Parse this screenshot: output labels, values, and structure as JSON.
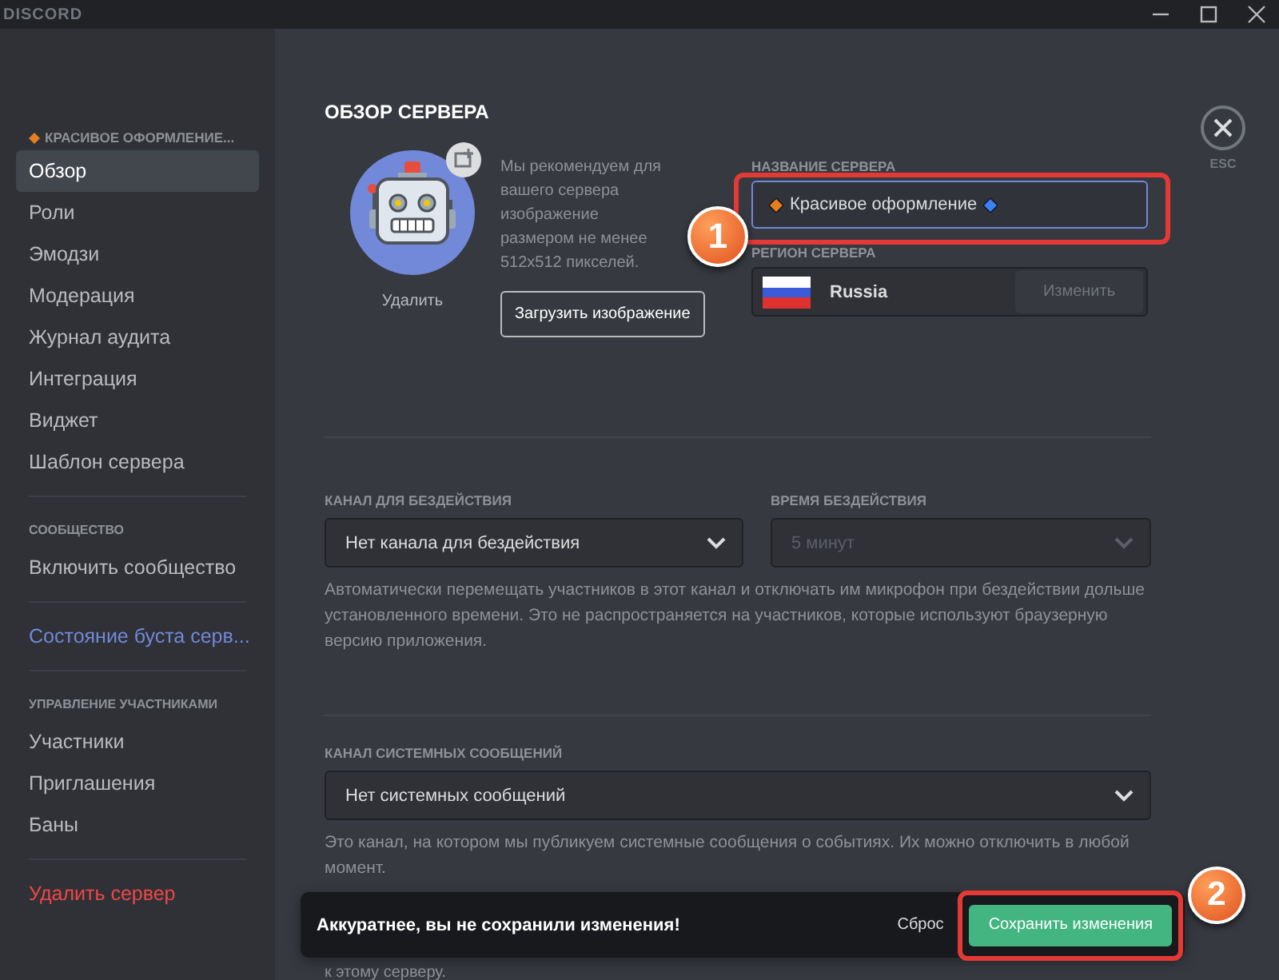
{
  "titlebar": {
    "app_name": "DISCORD"
  },
  "sidebar": {
    "server_name": "КРАСИВОЕ ОФОРМЛЕНИЕ...",
    "sections": [
      {
        "items": [
          {
            "label": "Обзор",
            "selected": true,
            "kind": "normal"
          },
          {
            "label": "Роли",
            "selected": false,
            "kind": "normal"
          },
          {
            "label": "Эмодзи",
            "selected": false,
            "kind": "normal"
          },
          {
            "label": "Модерация",
            "selected": false,
            "kind": "normal"
          },
          {
            "label": "Журнал аудита",
            "selected": false,
            "kind": "normal"
          },
          {
            "label": "Интеграция",
            "selected": false,
            "kind": "normal"
          },
          {
            "label": "Виджет",
            "selected": false,
            "kind": "normal"
          },
          {
            "label": "Шаблон сервера",
            "selected": false,
            "kind": "normal"
          }
        ]
      },
      {
        "heading": "СООБЩЕСТВО",
        "items": [
          {
            "label": "Включить сообщество",
            "selected": false,
            "kind": "normal"
          }
        ]
      },
      {
        "items": [
          {
            "label": "Состояние буста серв...",
            "selected": false,
            "kind": "boost"
          }
        ]
      },
      {
        "heading": "УПРАВЛЕНИЕ УЧАСТНИКАМИ",
        "items": [
          {
            "label": "Участники",
            "selected": false,
            "kind": "normal"
          },
          {
            "label": "Приглашения",
            "selected": false,
            "kind": "normal"
          },
          {
            "label": "Баны",
            "selected": false,
            "kind": "normal"
          }
        ]
      },
      {
        "items": [
          {
            "label": "Удалить сервер",
            "selected": false,
            "kind": "danger"
          }
        ]
      }
    ]
  },
  "overview": {
    "title": "ОБЗОР СЕРВЕРА",
    "icon_remove": "Удалить",
    "icon_hint": "Мы рекомендуем для вашего сервера изображение размером не менее 512x512 пикселей.",
    "upload_button": "Загрузить изображение",
    "name_label": "НАЗВАНИЕ СЕРВЕРА",
    "name_value": "Красивое оформление",
    "region_label": "РЕГИОН СЕРВЕРА",
    "region_value": "Russia",
    "region_change": "Изменить",
    "close_label": "ESC"
  },
  "idle": {
    "channel_label": "КАНАЛ ДЛЯ БЕЗДЕЙСТВИЯ",
    "channel_value": "Нет канала для бездействия",
    "timeout_label": "ВРЕМЯ БЕЗДЕЙСТВИЯ",
    "timeout_value": "5 минут",
    "timeout_disabled": true,
    "description": "Автоматически перемещать участников в этот канал и отключать им микрофон при бездействии дольше установленного времени. Это не распространяется на участников, которые используют браузерную версию приложения."
  },
  "system": {
    "label": "КАНАЛ СИСТЕМНЫХ СООБЩЕНИЙ",
    "value": "Нет системных сообщений",
    "description": "Это канал, на котором мы публикуем системные сообщения о событиях. Их можно отключить в любой момент.",
    "covered_tail": "к этому серверу."
  },
  "notice": {
    "message": "Аккуратнее, вы не сохранили изменения!",
    "reset": "Сброс",
    "save": "Сохранить изменения"
  },
  "annotations": [
    {
      "number": "1"
    },
    {
      "number": "2"
    }
  ]
}
